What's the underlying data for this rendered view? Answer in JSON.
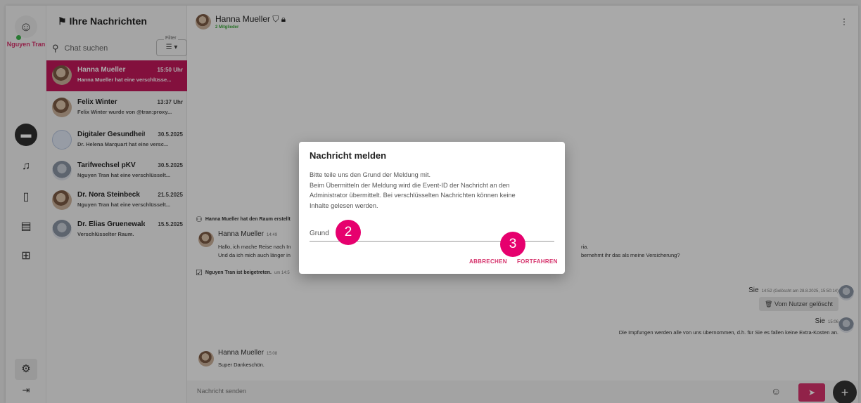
{
  "user": {
    "name": "Nguyen Tran"
  },
  "chatlist": {
    "title": "Ihre Nachrichten",
    "search_placeholder": "Chat suchen",
    "filter_label": "Filter",
    "items": [
      {
        "name": "Hanna Mueller",
        "time": "15:50 Uhr",
        "preview": "Hanna Mueller hat eine verschlüsse..."
      },
      {
        "name": "Felix Winter",
        "time": "13:37 Uhr",
        "preview": "Felix Winter wurde von @tran:proxy..."
      },
      {
        "name": "Digitaler Gesundheitsc...",
        "time": "30.5.2025",
        "preview": "Dr. Helena Marquart hat eine versc..."
      },
      {
        "name": "Tarifwechsel pKV",
        "time": "30.5.2025",
        "preview": "Nguyen Tran hat eine verschlüsselt..."
      },
      {
        "name": "Dr. Nora Steinbeck",
        "time": "21.5.2025",
        "preview": "Nguyen Tran hat eine verschlüsselt..."
      },
      {
        "name": "Dr. Elias Gruenewald",
        "time": "15.5.2025",
        "preview": "Verschlüsselter Raum."
      }
    ]
  },
  "room": {
    "title": "Hanna Mueller",
    "members": "2 Mitglieder"
  },
  "messages": {
    "created": "Hanna Mueller hat den Raum erstellt",
    "m1_name": "Hanna Mueller",
    "m1_time": "14:49",
    "m1_line1": "Hallo, ich mache Reise nach In",
    "m1_line1_tail": "ria.",
    "m1_line2": "Und da ich mich auch länger in",
    "m1_line2_tail": "bernehmt ihr das als meine Versicherung?",
    "joined": "Nguyen Tran ist beigetreten.",
    "joined_time": "um 14:5",
    "me1_name": "Sie",
    "me1_time": "14:52 (Gelöscht am 28.8.2025, 15:50:14)",
    "deleted": "Vom Nutzer gelöscht",
    "me2_name": "Sie",
    "me2_time": "15:06",
    "me2_text": "Die Impfungen werden alle von uns übernommen, d.h. für Sie es fallen keine Extra-Kosten an.",
    "m2_name": "Hanna Mueller",
    "m2_time": "15:08",
    "m2_text": "Super Dankeschön."
  },
  "composer": {
    "placeholder": "Nachricht senden"
  },
  "dialog": {
    "title": "Nachricht melden",
    "line1": "Bitte teile uns den Grund der Meldung mit.",
    "line2": "Beim Übermitteln der Meldung wird die Event-ID der Nachricht an den",
    "line3": "Administrator übermittelt. Bei verschlüsselten Nachrichten können keine",
    "line4": "Inhalte gelesen werden.",
    "field_label": "Grund",
    "cancel": "ABBRECHEN",
    "confirm": "FORTFAHREN"
  },
  "annotations": {
    "badge2": "2",
    "badge3": "3"
  },
  "colors": {
    "accent": "#c2185b",
    "badge": "#e6006e",
    "online": "#3cb34a"
  }
}
